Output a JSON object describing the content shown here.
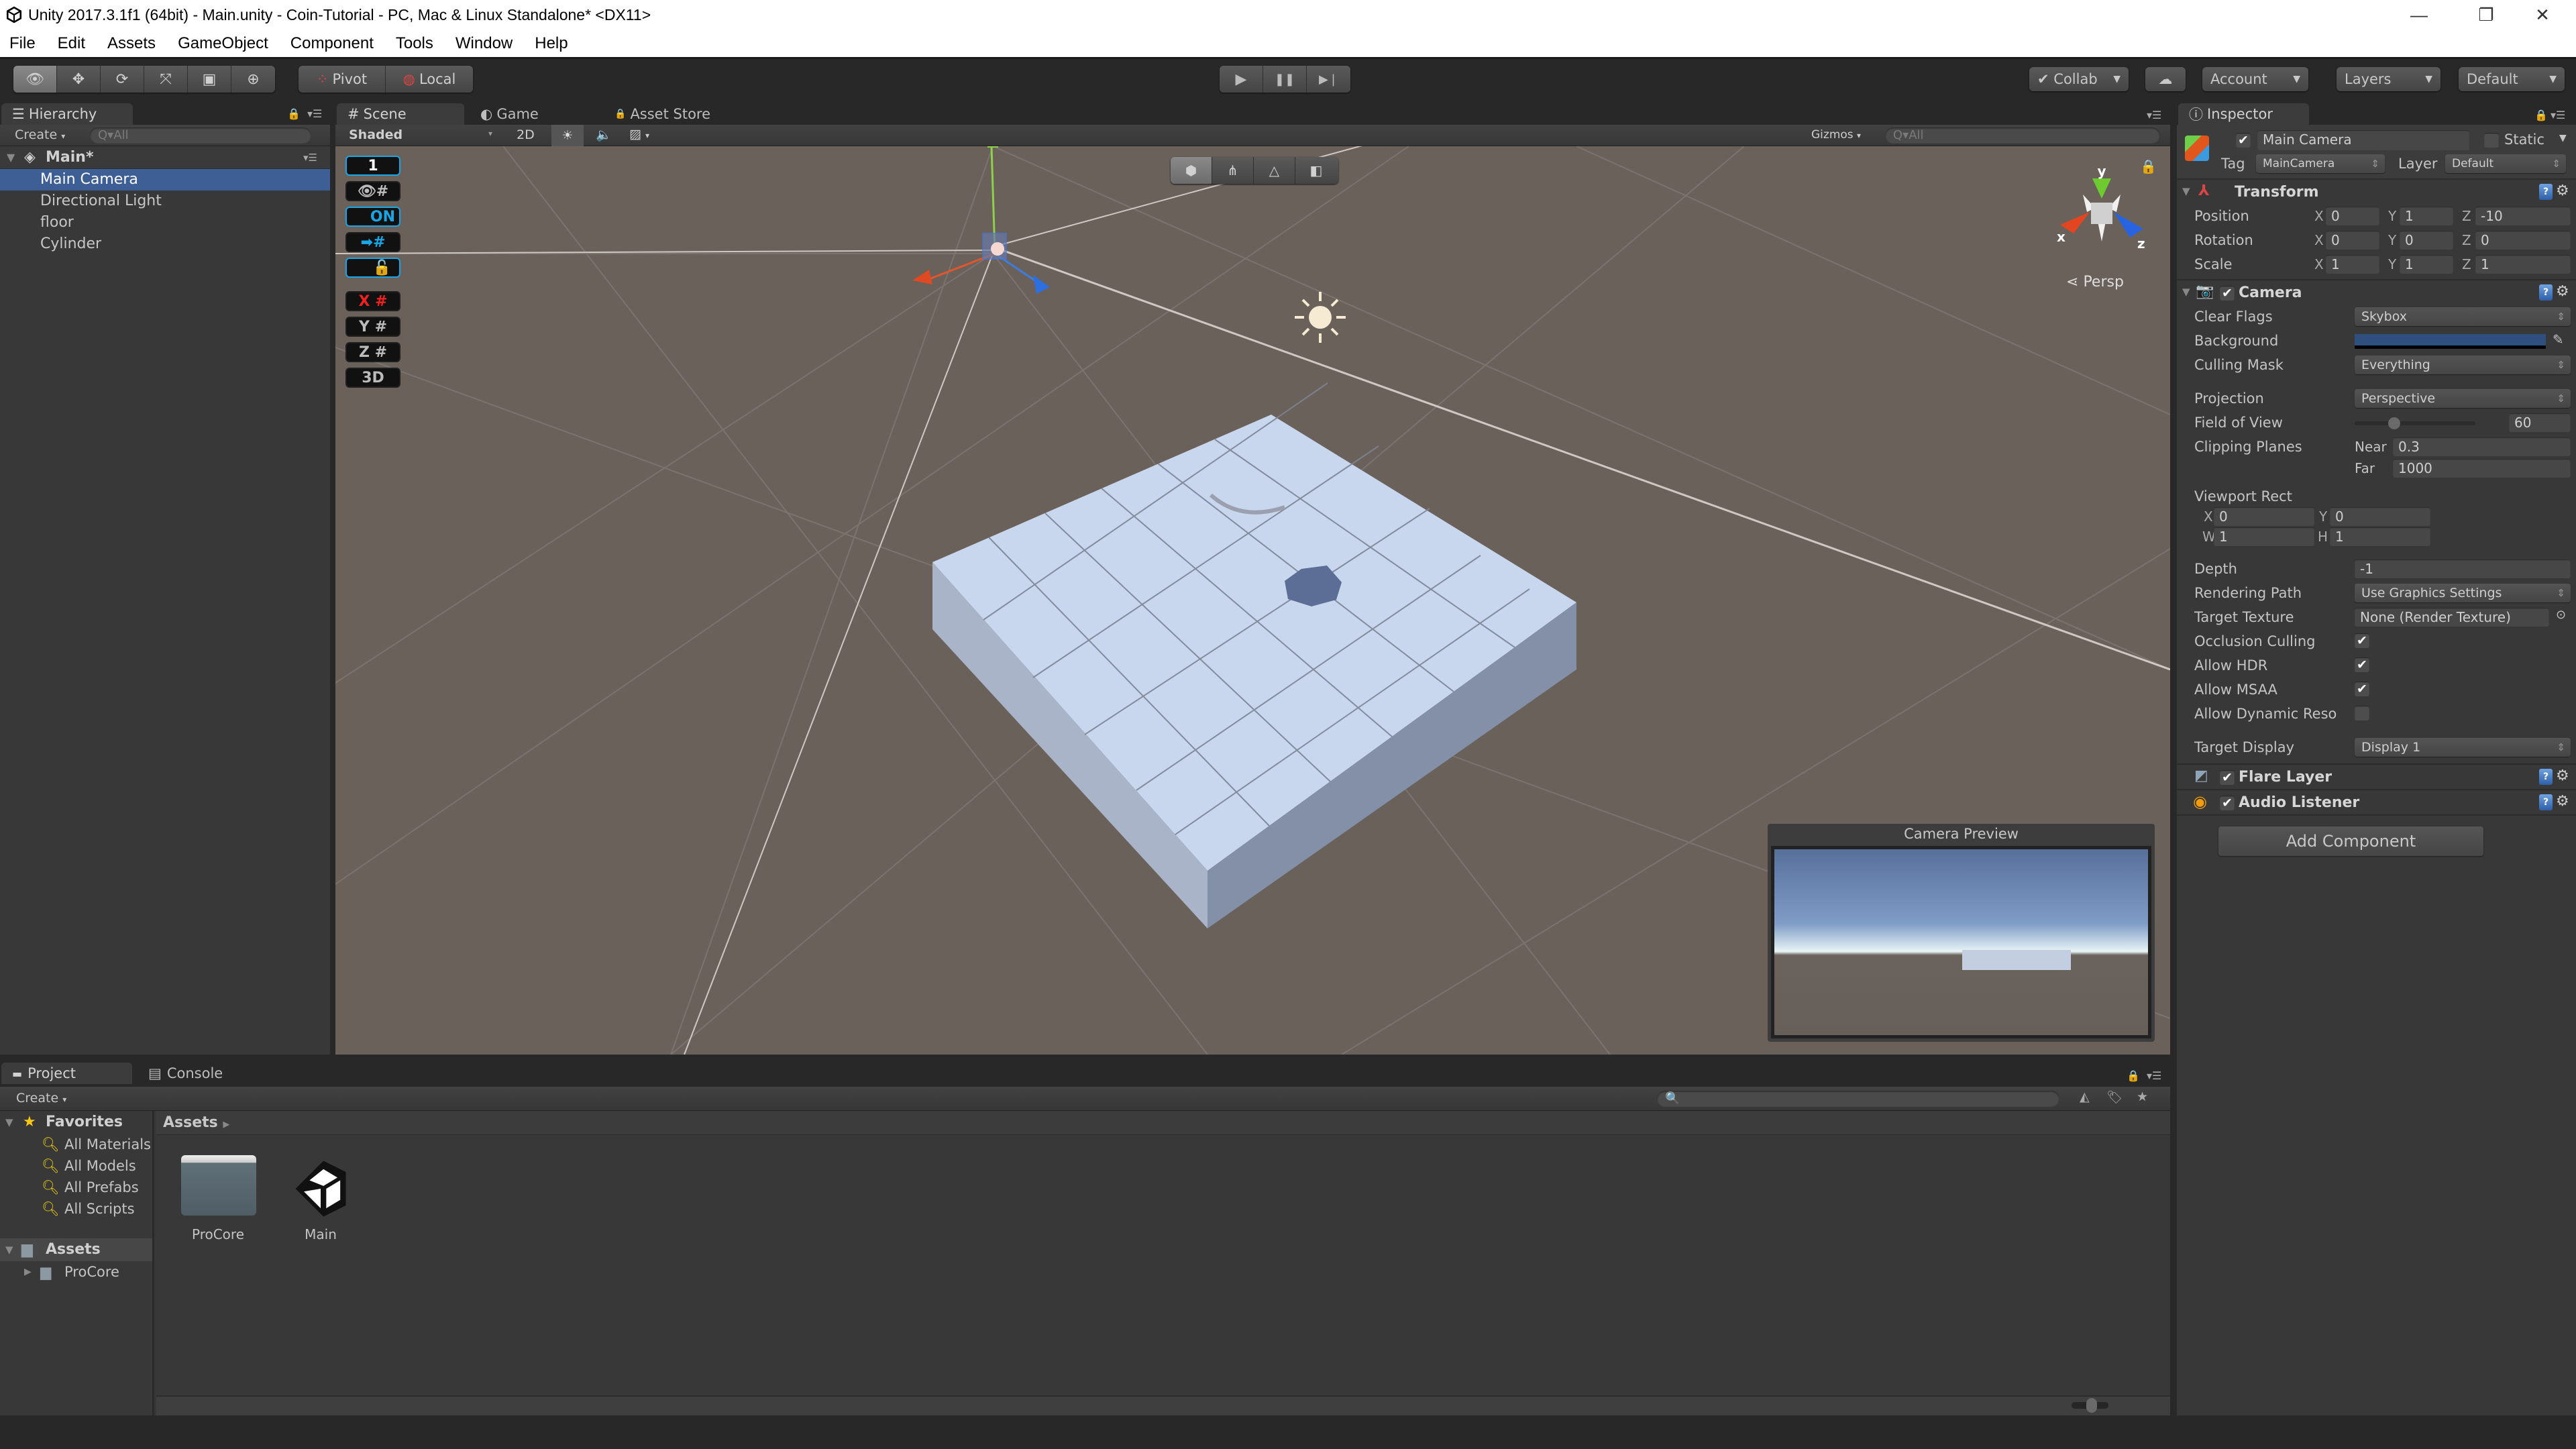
{
  "window": {
    "title": "Unity 2017.3.1f1 (64bit) - Main.unity - Coin-Tutorial - PC, Mac & Linux Standalone* <DX11>",
    "controls": {
      "minimize": "—",
      "restore": "❐",
      "close": "✕"
    }
  },
  "menu": [
    "File",
    "Edit",
    "Assets",
    "GameObject",
    "Component",
    "Tools",
    "Window",
    "Help"
  ],
  "toolbar": {
    "tools": [
      {
        "name": "view-tool",
        "glyph": "👁"
      },
      {
        "name": "move-tool",
        "glyph": "✥"
      },
      {
        "name": "rotate-tool",
        "glyph": "⟳"
      },
      {
        "name": "scale-tool",
        "glyph": "⤧"
      },
      {
        "name": "rect-tool",
        "glyph": "▣"
      },
      {
        "name": "transform-tool",
        "glyph": "⊕"
      }
    ],
    "pivot_label": "Pivot",
    "local_label": "Local",
    "play": "▶",
    "pause": "❚❚",
    "step": "▶❘",
    "collab_label": "Collab",
    "account_label": "Account",
    "layers_label": "Layers",
    "layout_label": "Default"
  },
  "hierarchy": {
    "tab_label": "Hierarchy",
    "create_label": "Create",
    "search_placeholder": "Q▾All",
    "scene_name": "Main*",
    "items": [
      {
        "label": "Main Camera",
        "selected": true
      },
      {
        "label": "Directional Light",
        "selected": false
      },
      {
        "label": "floor",
        "selected": false
      },
      {
        "label": "Cylinder",
        "selected": false
      }
    ]
  },
  "scene": {
    "tabs": [
      {
        "label": "Scene",
        "icon": "#"
      },
      {
        "label": "Game",
        "icon": "◐"
      },
      {
        "label": "Asset Store",
        "icon": "🔒"
      }
    ],
    "shading_mode": "Shaded",
    "mode_2d": "2D",
    "gizmos_label": "Gizmos",
    "search_placeholder": "Q▾All",
    "persp_label": "Persp",
    "gizmo_axes": {
      "x": "x",
      "y": "y",
      "z": "z"
    },
    "overlay_buttons": [
      "1",
      "👁#",
      "ON",
      "➡#",
      "🔓",
      "X #",
      "Y #",
      "Z #",
      "3D"
    ],
    "camera_preview_title": "Camera Preview"
  },
  "inspector": {
    "tab_label": "Inspector",
    "object_name": "Main Camera",
    "active": true,
    "static_label": "Static",
    "static": false,
    "tag_label": "Tag",
    "tag_value": "MainCamera",
    "layer_label": "Layer",
    "layer_value": "Default",
    "transform": {
      "title": "Transform",
      "position": {
        "label": "Position",
        "x": "0",
        "y": "1",
        "z": "-10"
      },
      "rotation": {
        "label": "Rotation",
        "x": "0",
        "y": "0",
        "z": "0"
      },
      "scale": {
        "label": "Scale",
        "x": "1",
        "y": "1",
        "z": "1"
      }
    },
    "camera": {
      "title": "Camera",
      "enabled": true,
      "clear_flags": {
        "label": "Clear Flags",
        "value": "Skybox"
      },
      "background": {
        "label": "Background",
        "color": "#2f4f7f"
      },
      "culling_mask": {
        "label": "Culling Mask",
        "value": "Everything"
      },
      "projection": {
        "label": "Projection",
        "value": "Perspective"
      },
      "fov": {
        "label": "Field of View",
        "value": "60",
        "slider_fraction": 0.33
      },
      "clipping": {
        "label": "Clipping Planes",
        "near_label": "Near",
        "near": "0.3",
        "far_label": "Far",
        "far": "1000"
      },
      "viewport": {
        "label": "Viewport Rect",
        "x": "0",
        "y": "0",
        "w": "1",
        "h": "1"
      },
      "depth": {
        "label": "Depth",
        "value": "-1"
      },
      "rendering_path": {
        "label": "Rendering Path",
        "value": "Use Graphics Settings"
      },
      "target_texture": {
        "label": "Target Texture",
        "value": "None (Render Texture)"
      },
      "occlusion_culling": {
        "label": "Occlusion Culling",
        "checked": true
      },
      "allow_hdr": {
        "label": "Allow HDR",
        "checked": true
      },
      "allow_msaa": {
        "label": "Allow MSAA",
        "checked": true
      },
      "allow_dynamic_reso": {
        "label": "Allow Dynamic Reso",
        "checked": false
      },
      "target_display": {
        "label": "Target Display",
        "value": "Display 1"
      }
    },
    "flare_layer": {
      "title": "Flare Layer",
      "enabled": true
    },
    "audio_listener": {
      "title": "Audio Listener",
      "enabled": true
    },
    "add_component_label": "Add Component"
  },
  "project": {
    "tabs": [
      {
        "label": "Project",
        "icon": "▬"
      },
      {
        "label": "Console",
        "icon": "▤"
      }
    ],
    "create_label": "Create",
    "favorites_label": "Favorites",
    "favorites": [
      "All Materials",
      "All Models",
      "All Prefabs",
      "All Scripts"
    ],
    "assets_label": "Assets",
    "asset_tree": [
      "ProCore"
    ],
    "breadcrumb": "Assets",
    "assets": [
      {
        "label": "ProCore",
        "type": "folder"
      },
      {
        "label": "Main",
        "type": "scene"
      }
    ],
    "icon_size_fraction": 0.55
  },
  "colors": {
    "selection": "#3e5f96",
    "scene_bg": "#6a615b",
    "accent_blue": "#19a6e6"
  }
}
